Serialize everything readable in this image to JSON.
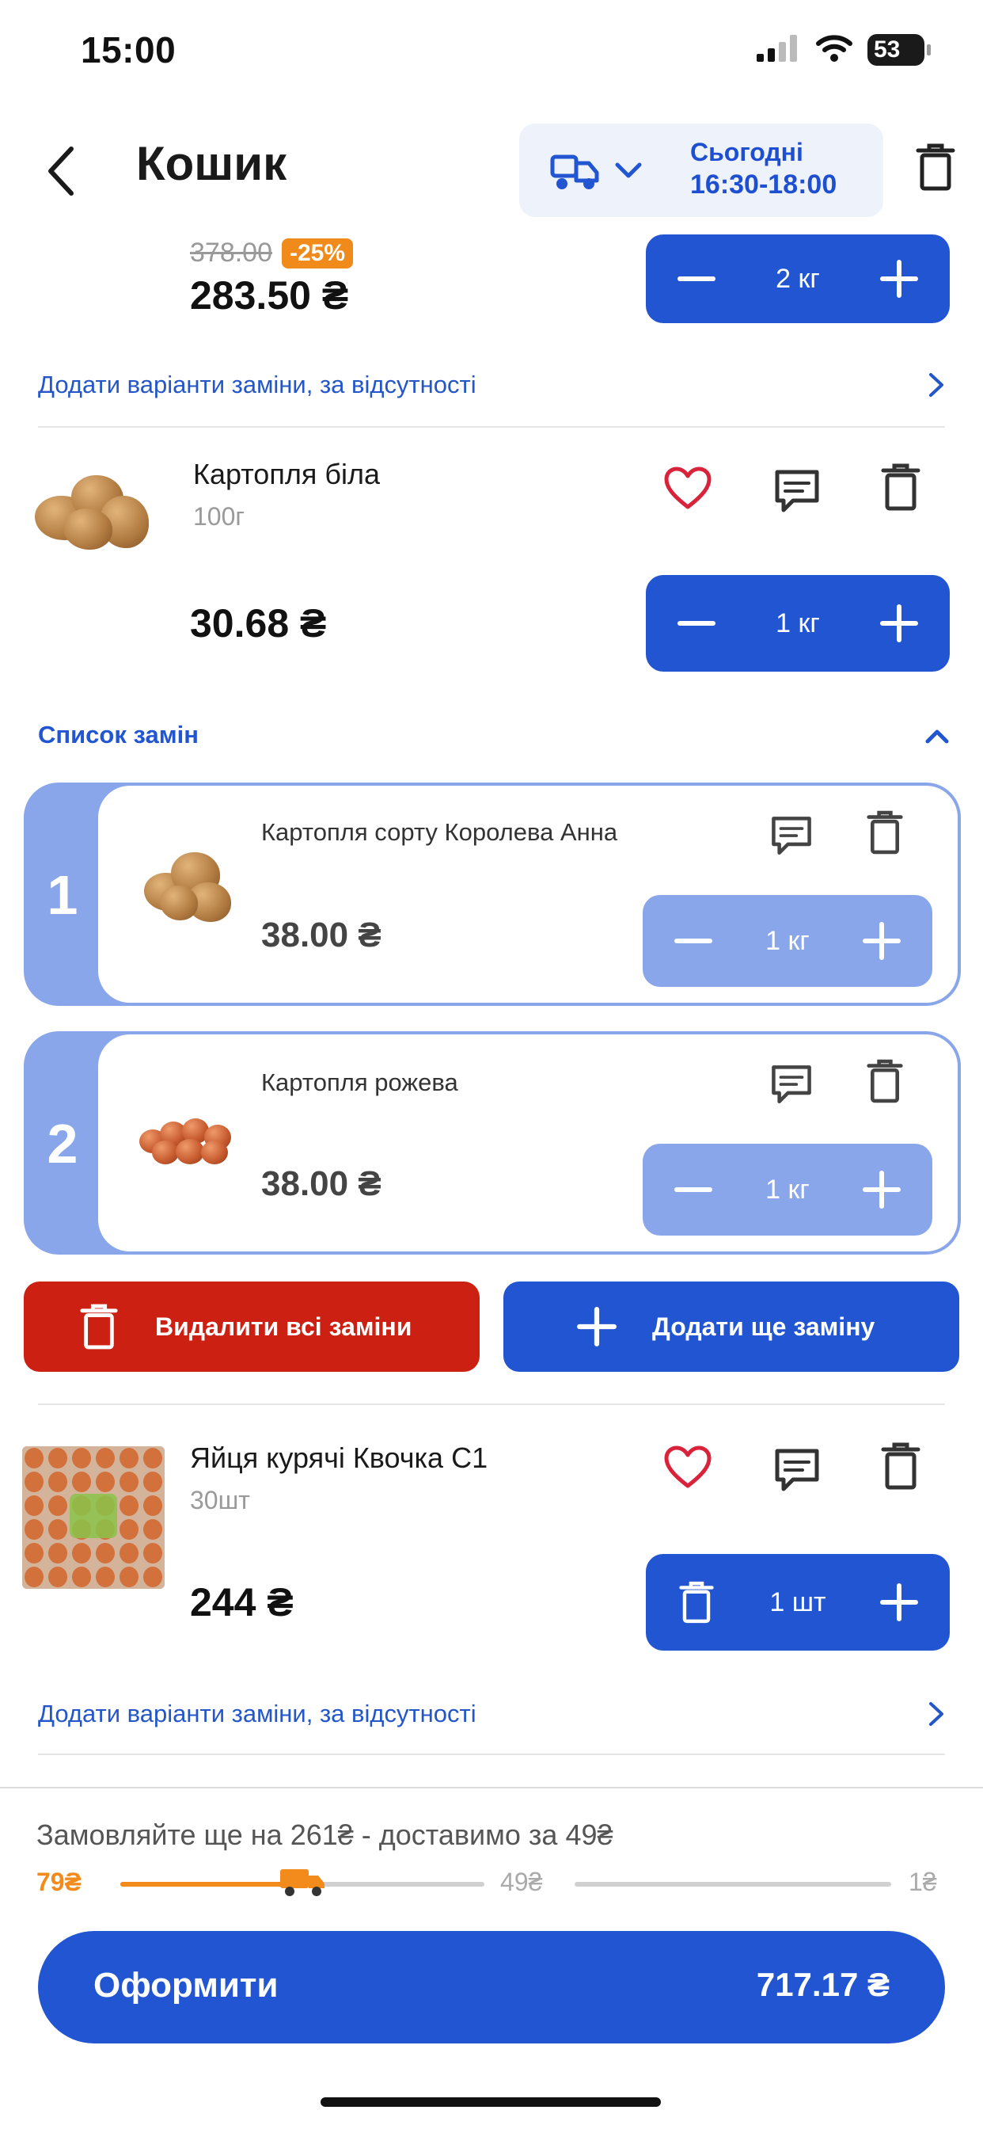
{
  "status_bar": {
    "time": "15:00",
    "battery": "53"
  },
  "header": {
    "title": "Кошик",
    "delivery_day": "Сьогодні",
    "delivery_time": "16:30-18:00"
  },
  "top_item": {
    "old_price": "378.00",
    "discount": "-25%",
    "price": "283.50 ₴",
    "qty": "2 кг"
  },
  "replace_link": "Додати варіанти заміни, за відсутності",
  "potato_item": {
    "name": "Картопля біла",
    "weight": "100г",
    "price": "30.68 ₴",
    "qty": "1 кг"
  },
  "substitutes": {
    "title": "Список замін",
    "items": [
      {
        "num": "1",
        "name": "Картопля сорту Королева Анна",
        "price": "38.00 ₴",
        "qty": "1 кг"
      },
      {
        "num": "2",
        "name": "Картопля рожева",
        "price": "38.00 ₴",
        "qty": "1 кг"
      }
    ],
    "delete_all_label": "Видалити всі заміни",
    "add_more_label": "Додати ще заміну"
  },
  "eggs_item": {
    "name": "Яйця курячі Квочка С1",
    "weight": "30шт",
    "price": "244 ₴",
    "qty": "1 шт"
  },
  "eggs_replace_link": "Додати варіанти заміни, за відсутності",
  "footer": {
    "promo": "Замовляйте ще на 261₴ - доставимо за 49₴",
    "progress": {
      "current": "79₴",
      "mid": "49₴",
      "end": "1₴",
      "fill_fraction": 0.5
    },
    "checkout_label": "Оформити",
    "total": "717.17 ₴"
  },
  "colors": {
    "accent": "#2255d1",
    "accent_light": "#8aa6eb",
    "danger": "#cc2012",
    "discount": "#f08a1a",
    "heart": "#d9233a",
    "progress": "#f28a1c"
  }
}
